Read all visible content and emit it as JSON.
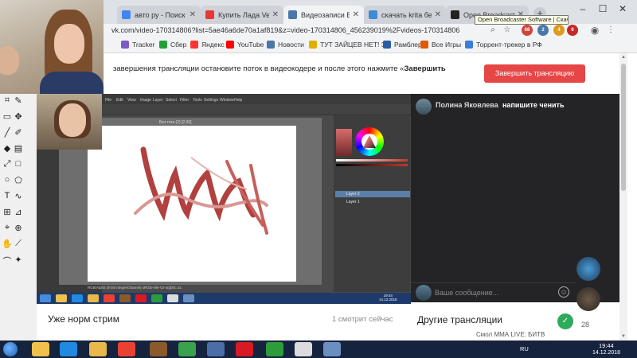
{
  "browser": {
    "tabs": [
      {
        "label": "авто ру - Поиск в Google",
        "favicon_color": "#4285f4",
        "active": false
      },
      {
        "label": "Купить Лада Vesta в Москве",
        "favicon_color": "#e53935",
        "active": false
      },
      {
        "label": "Видеозаписи Все",
        "favicon_color": "#4a76a8",
        "active": true
      },
      {
        "label": "скачать krita бесплатно",
        "favicon_color": "#3d8bd4",
        "active": false
      },
      {
        "label": "Open Broadcaster Software",
        "favicon_color": "#222222",
        "active": false
      }
    ],
    "new_tab": "+",
    "tooltip": "Open Broadcaster Software | Скачать",
    "window_controls": {
      "minimize": "–",
      "maximize": "☐",
      "close": "✕"
    },
    "url": "vk.com/video-170314806?list=5ae46a6de70a1af819&z=video-170314806_456239019%2Fvideos-170314806",
    "toolbar_icons": {
      "search": "⌕",
      "star": "☆",
      "menu": "⋮"
    },
    "extension_badges": [
      "68",
      "2",
      "4",
      "6"
    ],
    "bookmarks": [
      {
        "label": "Tracker",
        "color": "#7a5cc4"
      },
      {
        "label": "Сбер",
        "color": "#21a038"
      },
      {
        "label": "Яндекс",
        "color": "#ff3333"
      },
      {
        "label": "YouTube",
        "color": "#ff0000"
      },
      {
        "label": "Новости",
        "color": "#4a76a8"
      },
      {
        "label": "ТУТ ЗАЙЦЕВ НЕТ! З...",
        "color": "#e0b000"
      },
      {
        "label": "Рамблер",
        "color": "#2b5ca8"
      },
      {
        "label": "Все Игры",
        "color": "#e05a00"
      },
      {
        "label": "Торрент-трекер в РФ",
        "color": "#3b7dd8"
      }
    ]
  },
  "page": {
    "notice_prefix": "завершения трансляции остановите поток в видеокодере и после этого нажмите «",
    "notice_bold": "Завершить",
    "finish_button": "Завершить трансляцию",
    "stream_title": "Уже норм стрим",
    "viewers": "1 смотрит сейчас",
    "other_streams_title": "Другие трансляции",
    "other_stream_item": "Смол ММА LIVE: БИТВ",
    "side_count": "28"
  },
  "chat": {
    "author": "Полина Яковлева",
    "message": "напишите ченить",
    "input_placeholder": "Ваше сообщение...",
    "emoji_icon": "☺"
  },
  "krita": {
    "menu": [
      "File",
      "Edit",
      "View",
      "Image",
      "Layer",
      "Select",
      "Filter",
      "Tools",
      "Settings",
      "Window",
      "Help"
    ],
    "canvas_title": "Без тега (2) [2,00]",
    "status": "RGB/Alpha (8-bit integer/channel)  sRGB-elle-V2-srgbtrc.icc",
    "layers": [
      "Layer 2",
      "Layer 1"
    ],
    "stroke_colors": {
      "dark": "#b0413e",
      "light": "#d99894"
    }
  },
  "inner_clock": {
    "time": "19:44",
    "date": "14.12.2018"
  },
  "taskbar": {
    "language": "RU",
    "time": "19:44",
    "date": "14.12.2018",
    "apps": [
      {
        "name": "explorer",
        "color": "#f0c24b"
      },
      {
        "name": "internet-explorer",
        "color": "#1f8ae0"
      },
      {
        "name": "folder",
        "color": "#e8b84a"
      },
      {
        "name": "chrome",
        "color": "#e94235"
      },
      {
        "name": "paint",
        "color": "#8b5a2b"
      },
      {
        "name": "media",
        "color": "#3aa14c"
      },
      {
        "name": "opera",
        "color": "#d81a25"
      },
      {
        "name": "utorrent",
        "color": "#2d9c3a"
      },
      {
        "name": "obs",
        "color": "#dcdcdc"
      },
      {
        "name": "krita",
        "color": "#6b8fbf"
      }
    ]
  }
}
